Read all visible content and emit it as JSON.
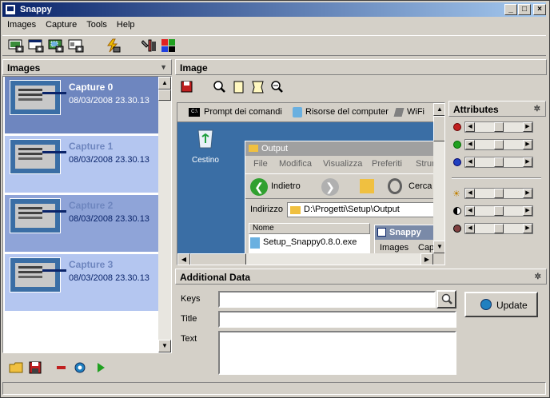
{
  "window": {
    "title": "Snappy",
    "min": "_",
    "max": "□",
    "close": "×"
  },
  "menu": [
    "Images",
    "Capture",
    "Tools",
    "Help"
  ],
  "toolbar": {
    "icons": [
      "capture-desktop-icon",
      "capture-window-icon",
      "capture-region-icon",
      "capture-object-icon",
      "flash-capture-icon",
      "tools-icon",
      "palette-icon"
    ]
  },
  "images_panel": {
    "title": "Images",
    "items": [
      {
        "name": "Capture 0",
        "date": "08/03/2008 23.30.13",
        "selected": true
      },
      {
        "name": "Capture 1",
        "date": "08/03/2008 23.30.13",
        "selected": false
      },
      {
        "name": "Capture 2",
        "date": "08/03/2008 23.30.13",
        "selected": false
      },
      {
        "name": "Capture 3",
        "date": "08/03/2008 23.30.13",
        "selected": false
      }
    ]
  },
  "image_panel": {
    "title": "Image"
  },
  "screenshot": {
    "taskbar": [
      "Prompt dei comandi",
      "Risorse del computer",
      "WiFi"
    ],
    "desktop_icon": "Cestino",
    "explorer": {
      "title": "Output",
      "menu": [
        "File",
        "Modifica",
        "Visualizza",
        "Preferiti",
        "Strum"
      ],
      "back": "Indietro",
      "search": "Cerca",
      "address_label": "Indirizzo",
      "address": "D:\\Progetti\\Setup\\Output",
      "col_name": "Nome",
      "file": "Setup_Snappy0.8.0.exe"
    },
    "inner_snappy": {
      "title": "Snappy",
      "menu1": "Images",
      "menu2": "Capt"
    }
  },
  "attributes": {
    "title": "Attributes"
  },
  "additional": {
    "title": "Additional Data",
    "keys_label": "Keys",
    "title_label": "Title",
    "text_label": "Text",
    "update": "Update"
  },
  "colors": {
    "selected": "#6e86bf",
    "unselected": "#b4c6f0",
    "title_bar": "#0a246a"
  }
}
